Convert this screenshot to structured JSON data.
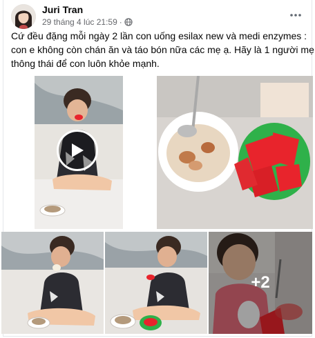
{
  "post": {
    "author": "Juri Tran",
    "timestamp": "29 tháng 4 lúc 21:59",
    "separator": "·",
    "privacy_icon": "globe-icon",
    "more_icon": "more-options-icon",
    "caption_lines": [
      "Cứ đều đặng mỗi ngày 2 lần con uống esilax new và medi enzymes :",
      "con e không còn chán ăn và táo bón nữa các mẹ ạ. Hãy là 1 người mẹ",
      "thông thái để  con luôn khỏe mạnh."
    ]
  },
  "media": {
    "video_play_icon": "play-icon",
    "more_photos_label": "+2"
  },
  "colors": {
    "text_primary": "#050505",
    "text_secondary": "#65676b",
    "border": "#e4e6eb",
    "plate_green": "#2fb14a",
    "watermelon_red": "#e8242c"
  }
}
